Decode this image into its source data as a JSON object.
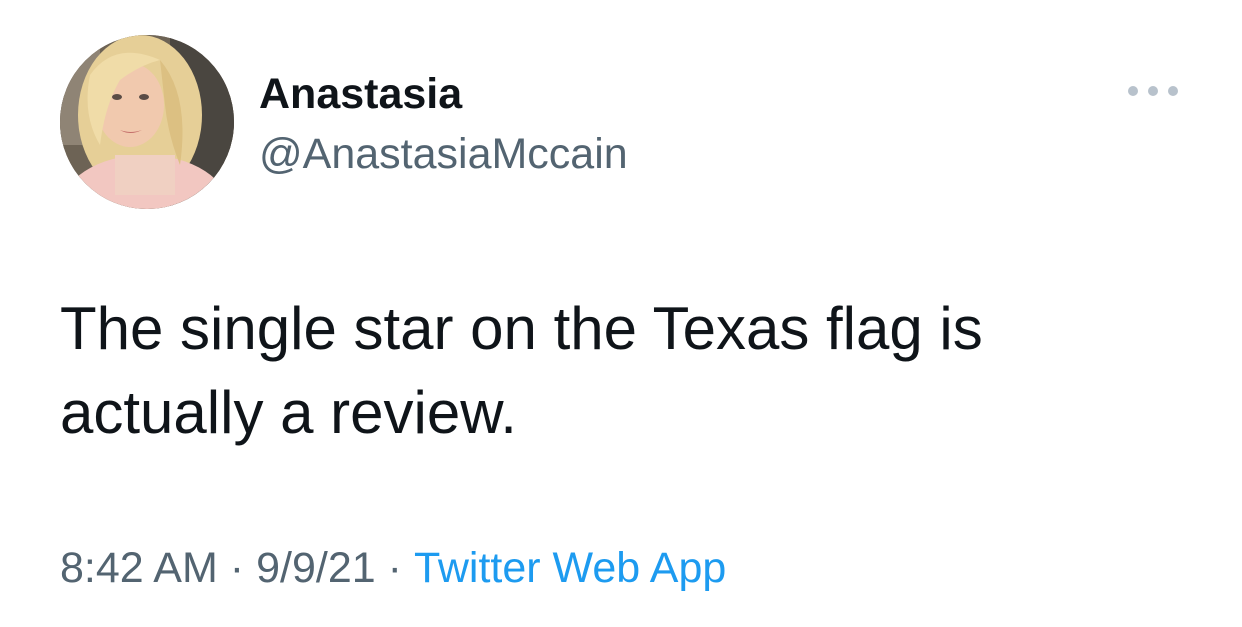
{
  "tweet": {
    "display_name": "Anastasia",
    "handle": "@AnastasiaMccain",
    "text": "The single star on the Texas flag is actually a review.",
    "time": "8:42 AM",
    "separator": "·",
    "date": "9/9/21",
    "source": "Twitter Web App"
  },
  "icons": {
    "more": "more-horizontal-icon"
  },
  "colors": {
    "text": "#0f1419",
    "secondary": "#536471",
    "link": "#1d9bf0",
    "background": "#ffffff"
  }
}
